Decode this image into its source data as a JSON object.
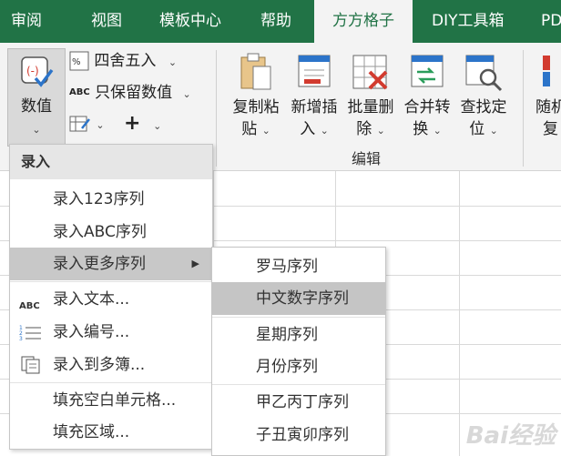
{
  "tabs": [
    "审阅",
    "视图",
    "模板中心",
    "帮助",
    "方方格子",
    "DIY工具箱",
    "PD"
  ],
  "ribbon": {
    "value_button": "数值",
    "round_label": "四舍五入",
    "keep_value_label": "只保留数值",
    "abc_icon_text": "ABC",
    "plus_label": "+",
    "copy_paste": [
      "复制粘",
      "贴"
    ],
    "add_insert": [
      "新增插",
      "入"
    ],
    "batch_delete": [
      "批量删",
      "除"
    ],
    "merge_convert": [
      "合并转",
      "换"
    ],
    "find_locate": [
      "查找定",
      "位"
    ],
    "random": [
      "随机",
      "复"
    ],
    "group_edit": "编辑",
    "dropdown_glyph": "⌄"
  },
  "menu": {
    "header": "录入",
    "items": [
      {
        "label": "录入123序列",
        "icon": ""
      },
      {
        "label": "录入ABC序列",
        "icon": ""
      },
      {
        "label": "录入更多序列",
        "icon": "",
        "submenu": true
      },
      {
        "label": "录入文本...",
        "icon": "ABC"
      },
      {
        "label": "录入编号...",
        "icon": "numbered-list-icon"
      },
      {
        "label": "录入到多簿...",
        "icon": "multi-workbook-icon"
      },
      {
        "label": "填充空白单元格...",
        "icon": ""
      },
      {
        "label": "填充区域...",
        "icon": ""
      }
    ],
    "submenu_arrow": "▶"
  },
  "submenu": {
    "items": [
      "罗马序列",
      "中文数字序列",
      "星期序列",
      "月份序列",
      "甲乙丙丁序列",
      "子丑寅卯序列"
    ]
  },
  "watermark": "Bai经验",
  "colors": {
    "accent": "#217346",
    "highlight": "#c8c8c8"
  }
}
